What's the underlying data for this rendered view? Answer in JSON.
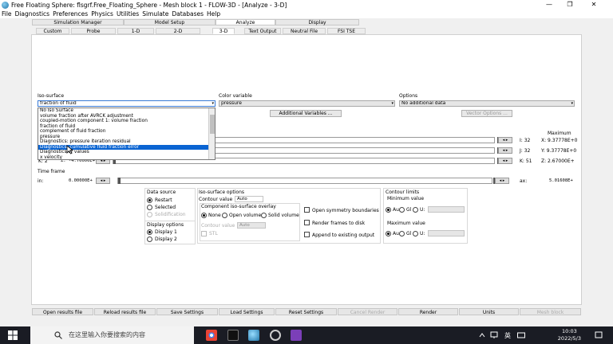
{
  "window": {
    "title": "Free Floating Sphere: flsgrf.Free_Floating_Sphere - Mesh block 1 - FLOW-3D - [Analyze - 3-D]",
    "controls": [
      "—",
      "❐",
      "✕"
    ]
  },
  "menu": [
    "File",
    "Diagnostics",
    "Preferences",
    "Physics",
    "Utilities",
    "Simulate",
    "Databases",
    "Help"
  ],
  "main_tabs": [
    "Simulation Manager",
    "Model Setup",
    "Analyze",
    "Display"
  ],
  "sub_tabs": [
    "Custom",
    "Probe",
    "1-D",
    "2-D",
    "3-D",
    "Text Output",
    "Neutral File",
    "FSI TSE"
  ],
  "iso_surface": {
    "label": "Iso-surface",
    "value": "fraction of fluid",
    "options": [
      "No Iso Surface",
      "volume fraction after AVRCK adjustment",
      "coupled-motion component 1: volume fraction",
      "fraction of fluid",
      "complement of fluid fraction",
      "pressure",
      "Diagnostics: pressure iteration residual",
      "Diagnostics: cumulative fluid fraction error",
      "Diagnostics of values",
      "x velocity"
    ],
    "selected_index": 7
  },
  "color_variable": {
    "label": "Color variable",
    "value": "pressure",
    "button": "Additional Variables ..."
  },
  "options": {
    "label": "Options",
    "value": "No additional data",
    "button": "Vector Options ..."
  },
  "limits": {
    "header": "Maximum",
    "rows": [
      {
        "axis_label": "",
        "value": "",
        "index": "I: 32",
        "max": "X: 9.37778E+0"
      },
      {
        "axis_label": "",
        "value": "",
        "index": "J: 32",
        "max": "Y: 9.37778E+0"
      },
      {
        "axis_label": "K: 2",
        "value": "Z: -4.70000E+",
        "index": "K: 51",
        "max": "Z: 2.67000E+"
      }
    ]
  },
  "time_frame": {
    "label": "Time frame",
    "min_label": "in:",
    "min_value": "0.00000E+",
    "max_label": "ax:",
    "max_value": "5.01608E+"
  },
  "data_source": {
    "label": "Data source",
    "options": [
      "Restart",
      "Selected",
      "Solidification"
    ],
    "selected": 0
  },
  "display_options": {
    "label": "Display options",
    "options": [
      "Display 1",
      "Display 2"
    ],
    "selected": 0
  },
  "iso_options": {
    "label": "Iso-surface options",
    "contour_label": "Contour value",
    "contour_value": "Auto",
    "overlay_label": "Component iso-surface overlay",
    "overlay_options": [
      "None",
      "Open volume",
      "Solid volume"
    ],
    "overlay_selected": 0,
    "overlay_contour_label": "Contour value",
    "overlay_contour_value": "Auto",
    "stl_label": "STL",
    "checks": [
      "Open symmetry boundaries",
      "Render frames to disk",
      "Append to existing output"
    ]
  },
  "contour_limits": {
    "label": "Contour limits",
    "min_label": "Minimum value",
    "max_label": "Maximum value",
    "radio_labels": [
      "Au",
      "Gl",
      "U:"
    ]
  },
  "bottom_buttons": [
    "Open results file",
    "Reload results file",
    "Save Settings",
    "Load Settings",
    "Reset Settings",
    "Cancel Render",
    "Render",
    "Units",
    "Mesh block"
  ],
  "taskbar": {
    "search_placeholder": "在这里输入你要搜索的内容",
    "ime": "英",
    "time": "10:03",
    "date": "2022/5/3"
  },
  "colors": {
    "selection": "#0a64d2",
    "taskbar": "#1a1c24"
  }
}
